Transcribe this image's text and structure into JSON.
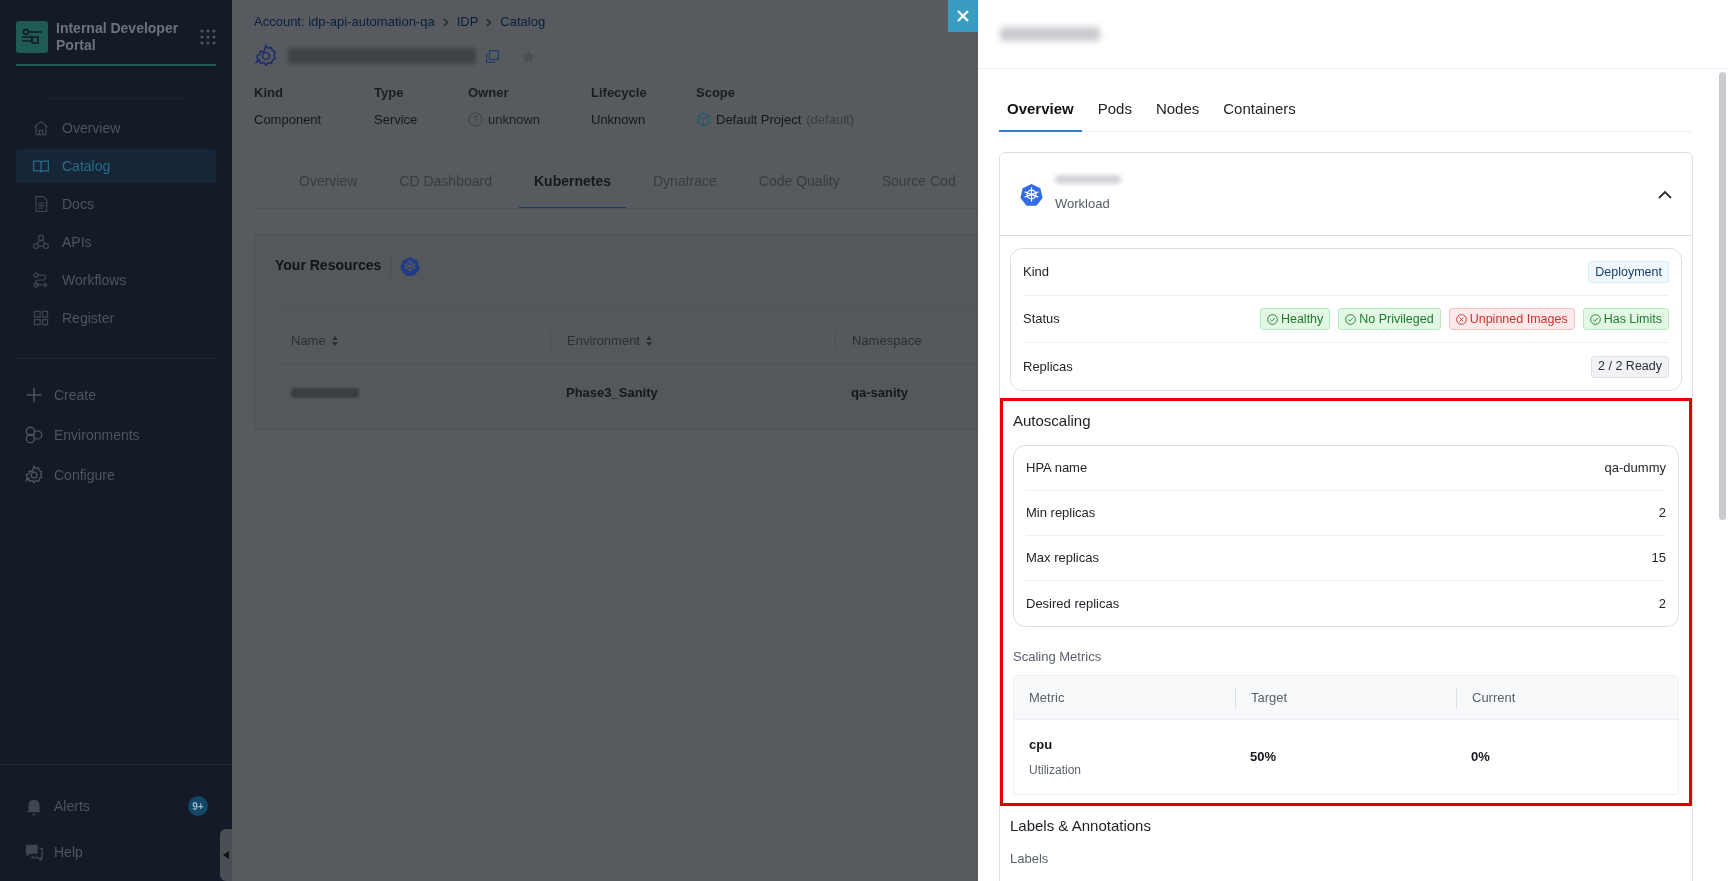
{
  "sidebar": {
    "brand": "Internal Developer Portal",
    "nav": [
      {
        "label": "Overview",
        "selected": false
      },
      {
        "label": "Catalog",
        "selected": true
      },
      {
        "label": "Docs",
        "selected": false
      },
      {
        "label": "APIs",
        "selected": false
      },
      {
        "label": "Workflows",
        "selected": false
      },
      {
        "label": "Register",
        "selected": false
      }
    ],
    "actions": [
      {
        "label": "Create"
      },
      {
        "label": "Environments"
      },
      {
        "label": "Configure"
      }
    ],
    "footer": [
      {
        "label": "Alerts",
        "badge": "9+"
      },
      {
        "label": "Help"
      }
    ]
  },
  "page": {
    "breadcrumbs": [
      "Account: idp-api-automation-qa",
      "IDP",
      "Catalog"
    ],
    "meta": [
      {
        "label": "Kind",
        "value": "Component",
        "kind": "plain"
      },
      {
        "label": "Type",
        "value": "Service",
        "kind": "plain"
      },
      {
        "label": "Owner",
        "value": "unknown",
        "kind": "owner"
      },
      {
        "label": "Lifecycle",
        "value": "Unknown",
        "kind": "plain"
      },
      {
        "label": "Scope",
        "value": "Default Project",
        "suffix": "(default)",
        "kind": "scope"
      }
    ],
    "tabs": [
      {
        "label": "Overview",
        "selected": false
      },
      {
        "label": "CD Dashboard",
        "selected": false
      },
      {
        "label": "Kubernetes",
        "selected": true
      },
      {
        "label": "Dynatrace",
        "selected": false
      },
      {
        "label": "Code Quality",
        "selected": false
      },
      {
        "label": "Source Cod",
        "selected": false
      }
    ],
    "resources": {
      "title": "Your Resources",
      "columns": [
        {
          "label": "Name",
          "sortable": true
        },
        {
          "label": "Environment",
          "sortable": true
        },
        {
          "label": "Namespace",
          "sortable": false
        }
      ],
      "rows": [
        {
          "environment": "Phase3_Sanity",
          "namespace": "qa-sanity"
        }
      ]
    }
  },
  "drawer": {
    "tabs": [
      {
        "label": "Overview",
        "selected": true
      },
      {
        "label": "Pods",
        "selected": false
      },
      {
        "label": "Nodes",
        "selected": false
      },
      {
        "label": "Containers",
        "selected": false
      }
    ],
    "workload": {
      "subtitle": "Workload",
      "expanded": true
    },
    "summary": [
      {
        "label": "Kind",
        "tags": [
          {
            "text": "Deployment",
            "kind": "info"
          }
        ]
      },
      {
        "label": "Status",
        "tags": [
          {
            "text": "Healthy",
            "kind": "pass"
          },
          {
            "text": "No Privileged",
            "kind": "pass"
          },
          {
            "text": "Unpinned Images",
            "kind": "fail"
          },
          {
            "text": "Has Limits",
            "kind": "pass"
          }
        ]
      },
      {
        "label": "Replicas",
        "tags": [
          {
            "text": "2 / 2 Ready",
            "kind": "neutral"
          }
        ]
      }
    ],
    "autoscaling": {
      "title": "Autoscaling",
      "highlighted": true,
      "rows": [
        {
          "label": "HPA name",
          "value": "qa-dummy"
        },
        {
          "label": "Min replicas",
          "value": "2"
        },
        {
          "label": "Max replicas",
          "value": "15"
        },
        {
          "label": "Desired replicas",
          "value": "2"
        }
      ],
      "metrics_title": "Scaling Metrics",
      "columns": [
        "Metric",
        "Target",
        "Current"
      ],
      "metrics": [
        {
          "metric": "cpu",
          "type": "Utilization",
          "target": "50%",
          "current": "0%"
        }
      ]
    },
    "labels": {
      "title": "Labels & Annotations",
      "subtitle": "Labels"
    }
  }
}
